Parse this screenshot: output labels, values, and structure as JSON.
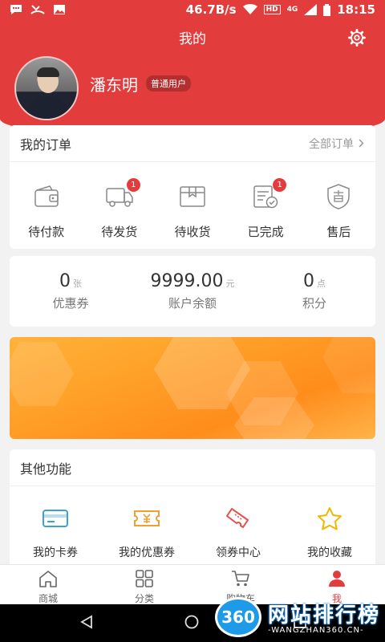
{
  "status_bar": {
    "speed": "46.7B/s",
    "hd": "HD",
    "network": "4G",
    "time": "18:15"
  },
  "header": {
    "title": "我的",
    "username": "潘东明",
    "user_level": "普通用户"
  },
  "orders": {
    "title": "我的订单",
    "all_label": "全部订单",
    "items": [
      {
        "label": "待付款",
        "icon": "wallet-icon",
        "badge": ""
      },
      {
        "label": "待发货",
        "icon": "truck-icon",
        "badge": "1"
      },
      {
        "label": "待收货",
        "icon": "package-icon",
        "badge": ""
      },
      {
        "label": "已完成",
        "icon": "done-list-icon",
        "badge": "1"
      },
      {
        "label": "售后",
        "icon": "after-sale-shield-icon",
        "badge": ""
      }
    ]
  },
  "assets": [
    {
      "value": "0",
      "unit": "张",
      "name": "优惠券"
    },
    {
      "value": "9999.00",
      "unit": "元",
      "name": "账户余额"
    },
    {
      "value": "0",
      "unit": "点",
      "name": "积分"
    }
  ],
  "functions": {
    "title": "其他功能",
    "items": [
      {
        "label": "我的卡券",
        "icon": "card-icon",
        "color": "#3aa0d8"
      },
      {
        "label": "我的优惠券",
        "icon": "coupon-icon",
        "color": "#f0a030"
      },
      {
        "label": "领券中心",
        "icon": "ticket-icon",
        "color": "#e5504a"
      },
      {
        "label": "我的收藏",
        "icon": "star-icon",
        "color": "#f4b400"
      }
    ]
  },
  "tabs": [
    {
      "label": "商城",
      "icon": "home-icon",
      "active": false
    },
    {
      "label": "分类",
      "icon": "grid-icon",
      "active": false
    },
    {
      "label": "购物车",
      "icon": "cart-icon",
      "active": false
    },
    {
      "label": "我",
      "icon": "user-icon",
      "active": true
    }
  ],
  "watermark": {
    "logo": "360",
    "text": "网站排行榜",
    "url": "-WANGZHAN360.CN-"
  },
  "colors": {
    "primary": "#e23d3c",
    "banner": "#ffa129"
  }
}
